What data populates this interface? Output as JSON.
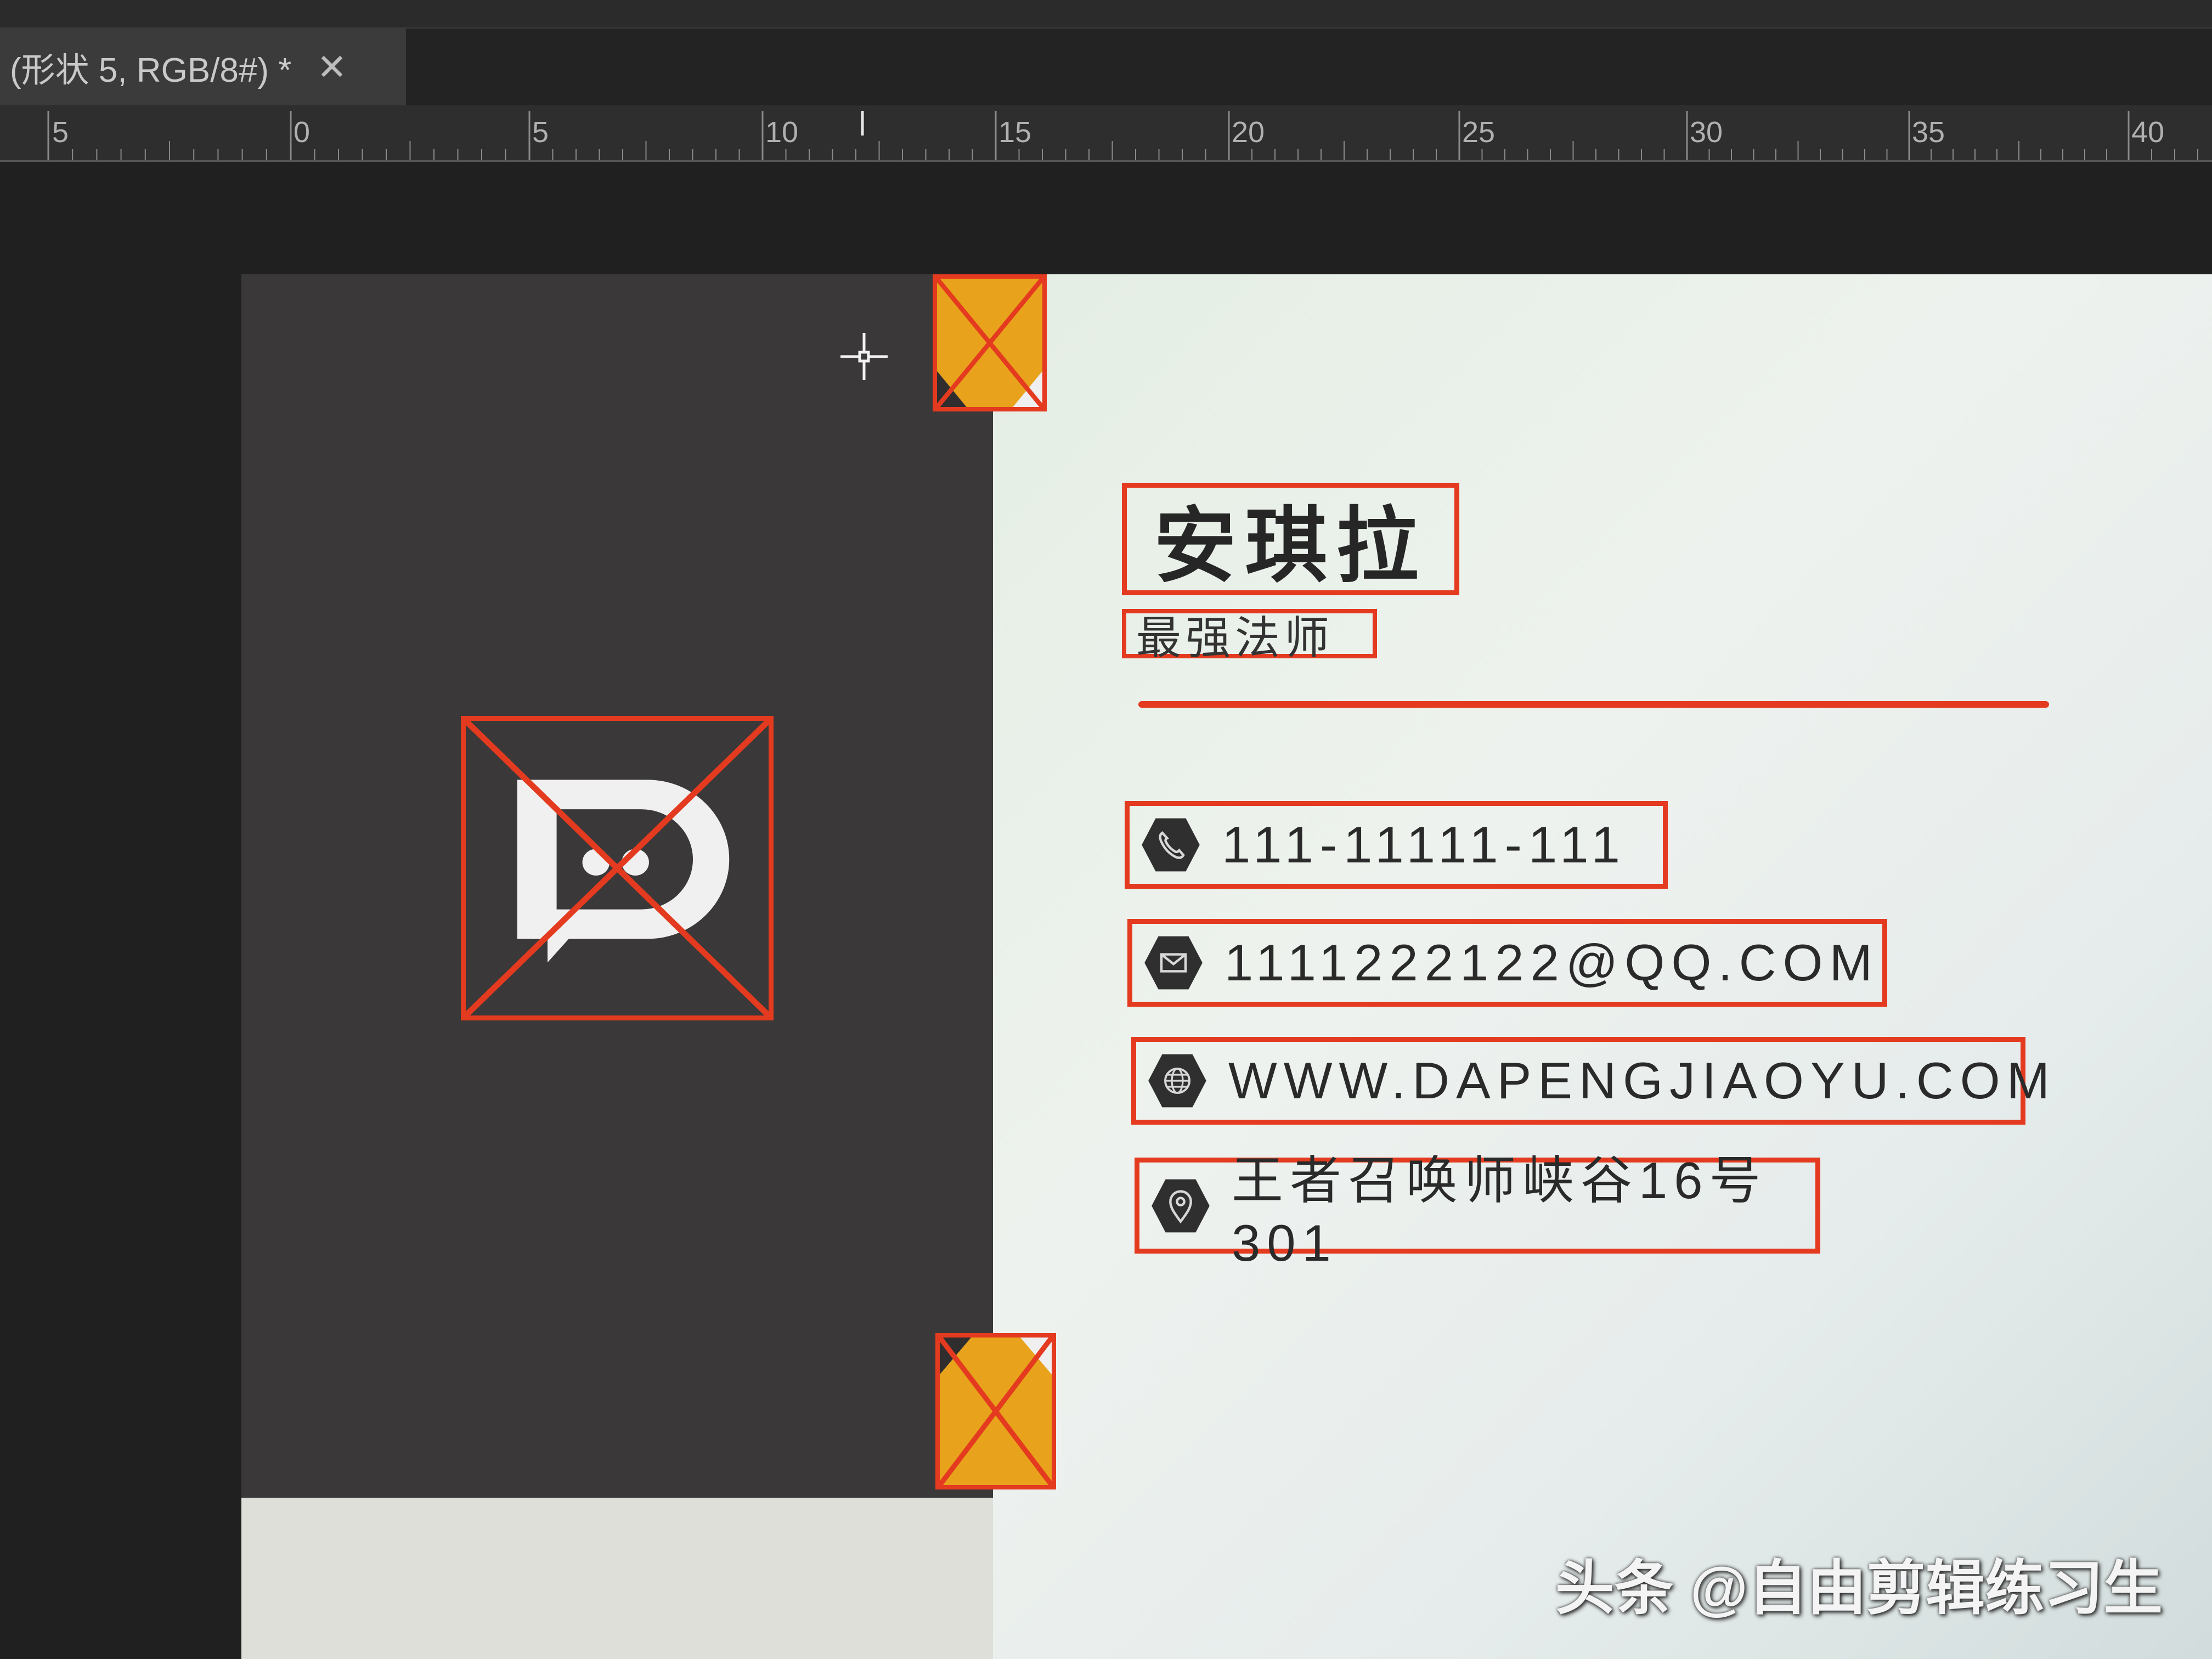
{
  "document_tab": {
    "title": "(形状 5, RGB/8#) *",
    "close_icon": "close-icon"
  },
  "ruler": {
    "labels": [
      "5",
      "0",
      "5",
      "10",
      "15",
      "20",
      "25",
      "30",
      "35",
      "40"
    ]
  },
  "card": {
    "name": "安琪拉",
    "title": "最强法师",
    "accent_color": "#e43a1f",
    "placeholder_color": "#e8a21c",
    "dark_panel_color": "#3a3838",
    "logo_letter": "D",
    "contacts": [
      {
        "icon": "phone-icon",
        "text": "111-11111-111"
      },
      {
        "icon": "mail-icon",
        "text": "1111222122@QQ.COM"
      },
      {
        "icon": "globe-icon",
        "text": "WWW.DAPENGJIAOYU.COM"
      },
      {
        "icon": "location-pin-icon",
        "text": "王者召唤师峡谷16号301"
      }
    ]
  },
  "watermark": "头条 @自由剪辑练习生"
}
